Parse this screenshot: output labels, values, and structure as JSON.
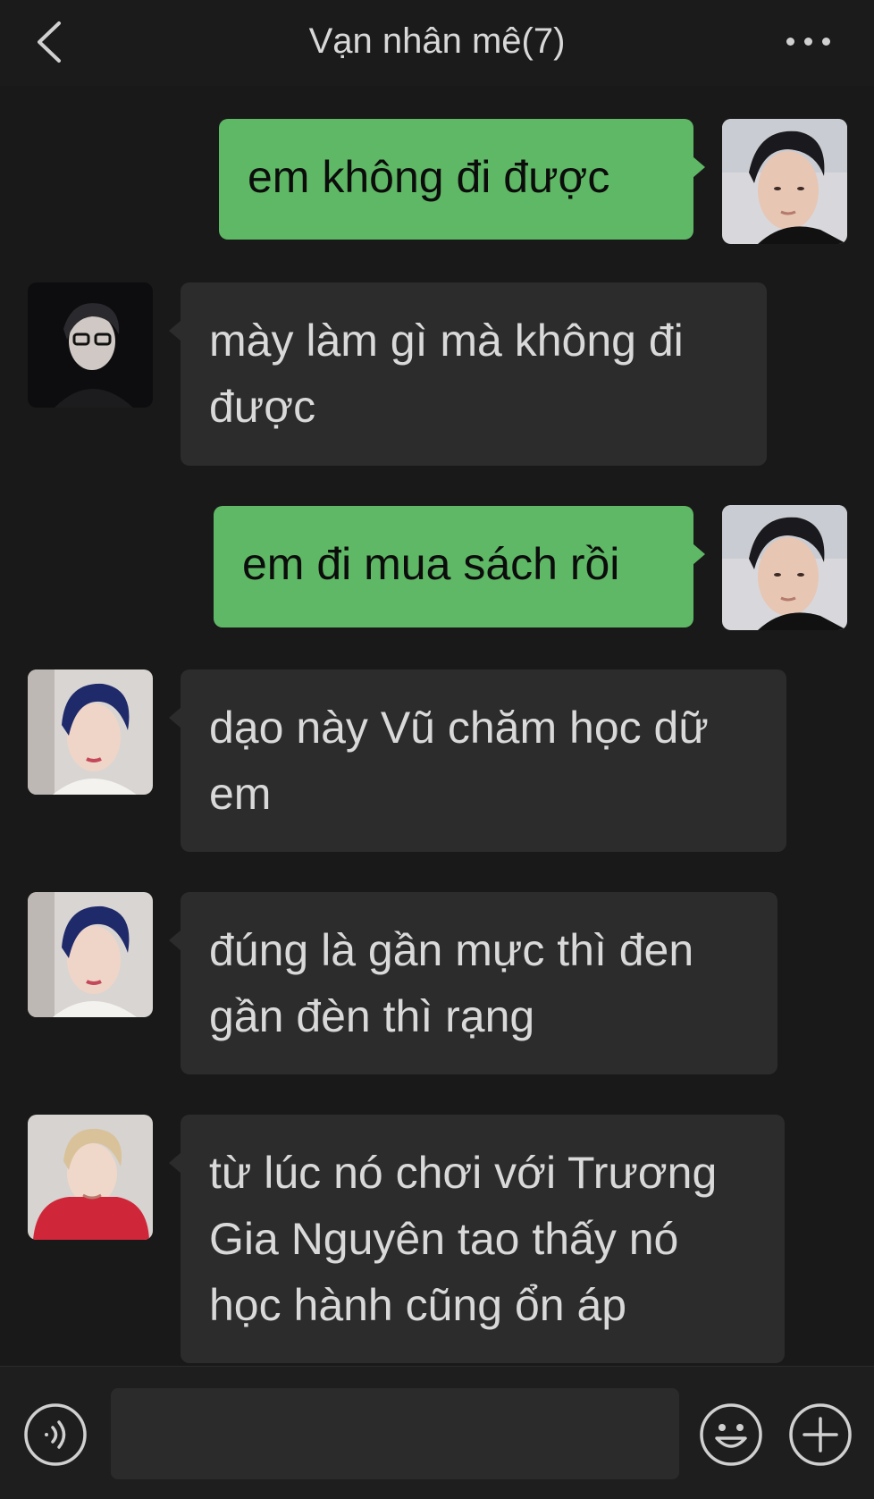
{
  "header": {
    "title": "Vạn nhân mê(7)"
  },
  "messages": [
    {
      "sender": "me",
      "avatar": "avatar-self",
      "text": "em không đi được"
    },
    {
      "sender": "member",
      "avatar": "avatar-glasses",
      "lines": [
        "mày làm gì mà không đi",
        "được"
      ]
    },
    {
      "sender": "me",
      "avatar": "avatar-self",
      "text": "em đi mua sách rồi"
    },
    {
      "sender": "member",
      "avatar": "avatar-blue-hair",
      "lines": [
        "dạo này Vũ chăm học dữ",
        "em"
      ]
    },
    {
      "sender": "member",
      "avatar": "avatar-blue-hair",
      "lines": [
        "đúng là gần mực thì đen",
        "gần đèn thì rạng"
      ]
    },
    {
      "sender": "member",
      "avatar": "avatar-red-hoodie",
      "lines": [
        "từ lúc nó chơi với Trương",
        "Gia Nguyên tao thấy nó",
        "học hành cũng ổn áp"
      ]
    }
  ],
  "input_bar": {
    "text_value": ""
  },
  "icons": {
    "back": "chevron-left-icon",
    "more": "more-dots-icon",
    "voice": "voice-icon",
    "emoji": "emoji-icon",
    "plus": "plus-icon"
  },
  "colors": {
    "background": "#191919",
    "my_bubble": "#5fb865",
    "other_bubble": "#2c2c2c",
    "text_light": "#d9d9d9"
  }
}
